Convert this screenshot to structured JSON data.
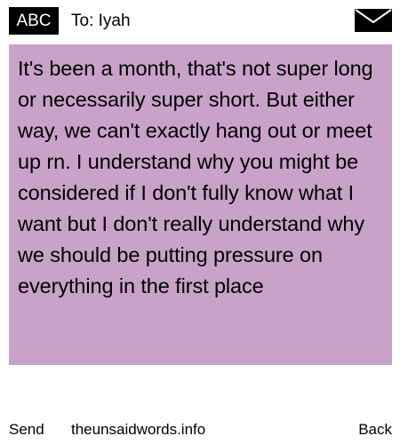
{
  "header": {
    "badge": "ABC",
    "to": "To: Iyah"
  },
  "message": {
    "text": "It's been a month, that's not super long or necessarily super short. But either way, we can't exactly hang out or meet up rn. I understand why you might be considered if I don't fully know what I want but I don't really understand why we should be putting pressure on everything in the first place"
  },
  "footer": {
    "send": "Send",
    "site": "theunsaidwords.info",
    "back": "Back"
  },
  "colors": {
    "message_bg": "#c8a2c8",
    "badge_bg": "#000000"
  },
  "icons": {
    "envelope": "envelope-icon"
  }
}
